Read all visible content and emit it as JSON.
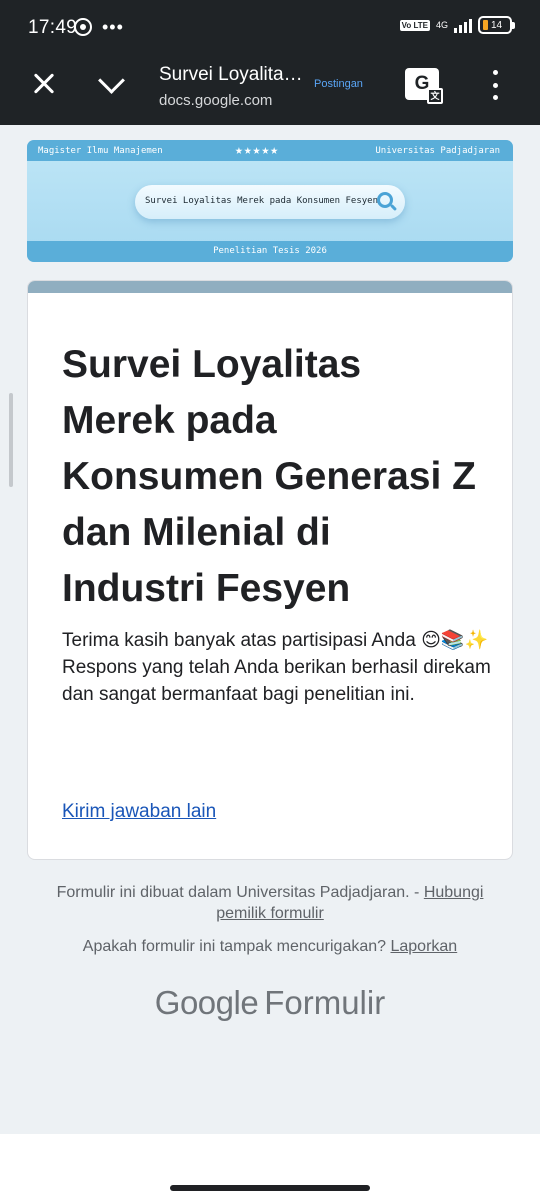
{
  "status_bar": {
    "time": "17:49",
    "whatsapp_icon": "whatsapp-icon",
    "more_dots": "•••",
    "volte": "Vo LTE",
    "network": "4G",
    "battery": "14"
  },
  "app_bar": {
    "title": "Survei Loyalitas Merek pada Konsumen Fesyen",
    "url": "docs.google.com",
    "postingan": "Postingan",
    "translate_label": "G"
  },
  "banner": {
    "left_text": "Magister Ilmu Manajemen",
    "stars": "★★★★★",
    "right_text": "Universitas Padjadjaran",
    "search_text": "Survei Loyalitas Merek pada Konsumen Fesyen",
    "bottom_text": "Penelitian Tesis 2026"
  },
  "card": {
    "title": "Survei Loyalitas Merek pada Konsumen Generasi Z dan Milenial di Industri Fesyen",
    "message": "Terima kasih banyak atas partisipasi Anda 😊📚✨\nRespons yang telah Anda berikan berhasil direkam dan sangat bermanfaat bagi penelitian ini.",
    "link": "Kirim jawaban lain"
  },
  "footer": {
    "made_text": "Formulir ini dibuat dalam Universitas Padjadjaran. - ",
    "contact_link": "Hubungi pemilik formulir",
    "report_question": "Apakah formulir ini tampak mencurigakan? ",
    "report_link": "Laporkan",
    "logo_google": "Google",
    "logo_formulir": "Formulir"
  }
}
